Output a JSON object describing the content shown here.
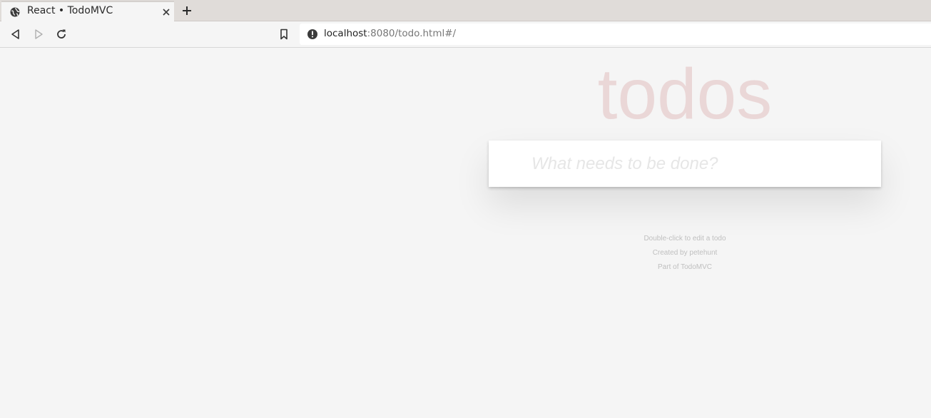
{
  "browser": {
    "tab": {
      "title": "React • TodoMVC",
      "favicon_icon": "globe-icon",
      "close_icon": "close-icon"
    },
    "new_tab_icon": "plus-icon",
    "nav": {
      "back_icon": "back-arrow-icon",
      "forward_icon": "forward-arrow-icon",
      "reload_icon": "reload-icon",
      "bookmark_icon": "bookmark-icon"
    },
    "url": {
      "info_icon": "info-icon",
      "host": "localhost",
      "rest": ":8080/todo.html#/"
    }
  },
  "app": {
    "title": "todos",
    "new_todo_placeholder": "What needs to be done?",
    "new_todo_value": "",
    "info": {
      "line1": "Double-click to edit a todo",
      "line2": "Created by petehunt",
      "line3": "Part of TodoMVC"
    },
    "colors": {
      "title": "#af2f2f",
      "background": "#f5f5f5",
      "placeholder": "#e6e6e6"
    }
  }
}
